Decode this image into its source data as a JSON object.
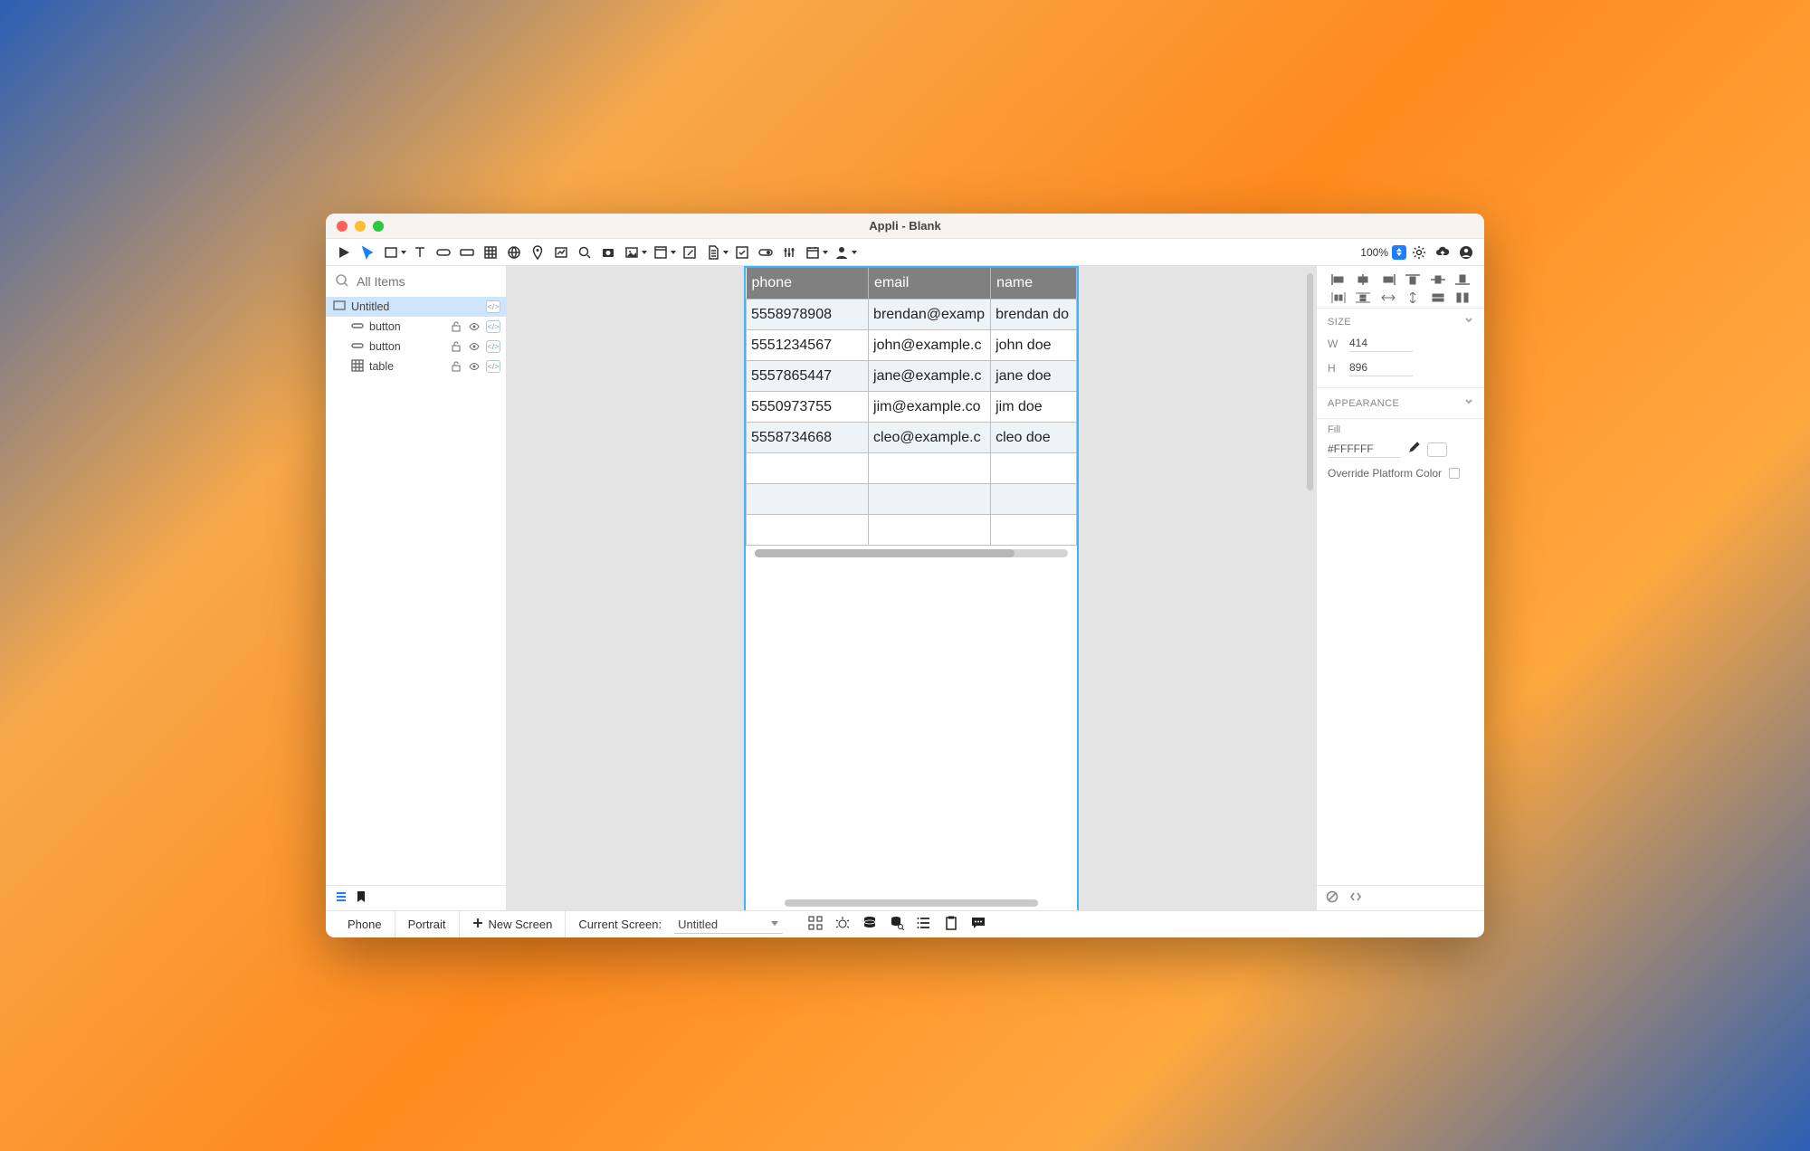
{
  "window_title": "Appli - Blank",
  "toolbar": {
    "zoom": "100%"
  },
  "sidebar": {
    "search_placeholder": "All Items",
    "items": [
      {
        "label": "Untitled",
        "kind": "screen",
        "selected": true
      },
      {
        "label": "button",
        "kind": "button"
      },
      {
        "label": "button",
        "kind": "button"
      },
      {
        "label": "table",
        "kind": "table"
      }
    ]
  },
  "canvas": {
    "table": {
      "columns": [
        "phone",
        "email",
        "name"
      ],
      "rows": [
        {
          "phone": "5558978908",
          "email": "brendan@examp",
          "name": "brendan do"
        },
        {
          "phone": "5551234567",
          "email": "john@example.c",
          "name": "john doe"
        },
        {
          "phone": "5557865447",
          "email": "jane@example.c",
          "name": "jane doe"
        },
        {
          "phone": "5550973755",
          "email": "jim@example.co",
          "name": "jim doe"
        },
        {
          "phone": "5558734668",
          "email": "cleo@example.c",
          "name": "cleo doe"
        },
        {
          "phone": "",
          "email": "",
          "name": ""
        },
        {
          "phone": "",
          "email": "",
          "name": ""
        },
        {
          "phone": "",
          "email": "",
          "name": ""
        }
      ]
    }
  },
  "inspector": {
    "size_label": "SIZE",
    "w_label": "W",
    "w_value": "414",
    "h_label": "H",
    "h_value": "896",
    "appearance_label": "APPEARANCE",
    "fill_label": "Fill",
    "fill_value": "#FFFFFF",
    "override_label": "Override Platform Color"
  },
  "statusbar": {
    "device": "Phone",
    "orientation": "Portrait",
    "new_screen": "New Screen",
    "current_screen_label": "Current Screen:",
    "current_screen_value": "Untitled"
  }
}
